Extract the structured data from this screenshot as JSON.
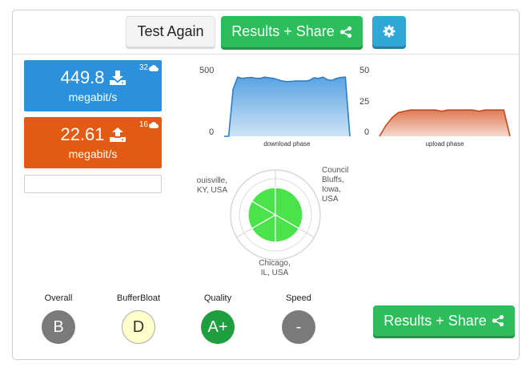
{
  "buttons": {
    "test_again": "Test Again",
    "results_share": "Results + Share",
    "results_share_bottom": "Results + Share"
  },
  "download": {
    "value": "449.8",
    "unit": "megabit/s",
    "count": "32",
    "color": "#2c91dd"
  },
  "upload": {
    "value": "22.61",
    "unit": "megabit/s",
    "count": "16",
    "color": "#e35b13"
  },
  "download_chart": {
    "y_max_label": "500",
    "y_min_label": "0",
    "caption": "download phase",
    "values": [
      0,
      0,
      360,
      450,
      440,
      445,
      448,
      442,
      440,
      450,
      445,
      440,
      430,
      420,
      415,
      418,
      420,
      420,
      420,
      425,
      445,
      440,
      450,
      430,
      425,
      440,
      448,
      450,
      0
    ]
  },
  "upload_chart": {
    "y_max_label": "50",
    "y_mid_label": "25",
    "y_min_label": "0",
    "caption": "upload phase",
    "values": [
      0,
      8,
      14,
      18,
      19,
      20,
      20,
      20,
      20,
      20,
      19,
      20,
      20,
      20,
      20,
      20,
      19,
      20,
      20,
      20,
      20,
      0
    ]
  },
  "locations": {
    "left": [
      "ouisville,",
      "KY, USA"
    ],
    "right": [
      "Council",
      "Bluffs,",
      "Iowa,",
      "USA"
    ],
    "bottom": [
      "Chicago,",
      "IL, USA"
    ]
  },
  "grades": [
    {
      "label": "Overall",
      "value": "B",
      "bg": "#7a7a7a",
      "fg": "#ffffff"
    },
    {
      "label": "BufferBloat",
      "value": "D",
      "bg": "#ffffcc",
      "fg": "#333333"
    },
    {
      "label": "Quality",
      "value": "A+",
      "bg": "#1e9e3e",
      "fg": "#ffffff"
    },
    {
      "label": "Speed",
      "value": "-",
      "bg": "#7a7a7a",
      "fg": "#ffffff"
    }
  ],
  "icons": {
    "share": "share-icon",
    "gear": "gear-icon",
    "download": "download-icon",
    "upload": "upload-icon",
    "cloud": "cloud-icon"
  }
}
